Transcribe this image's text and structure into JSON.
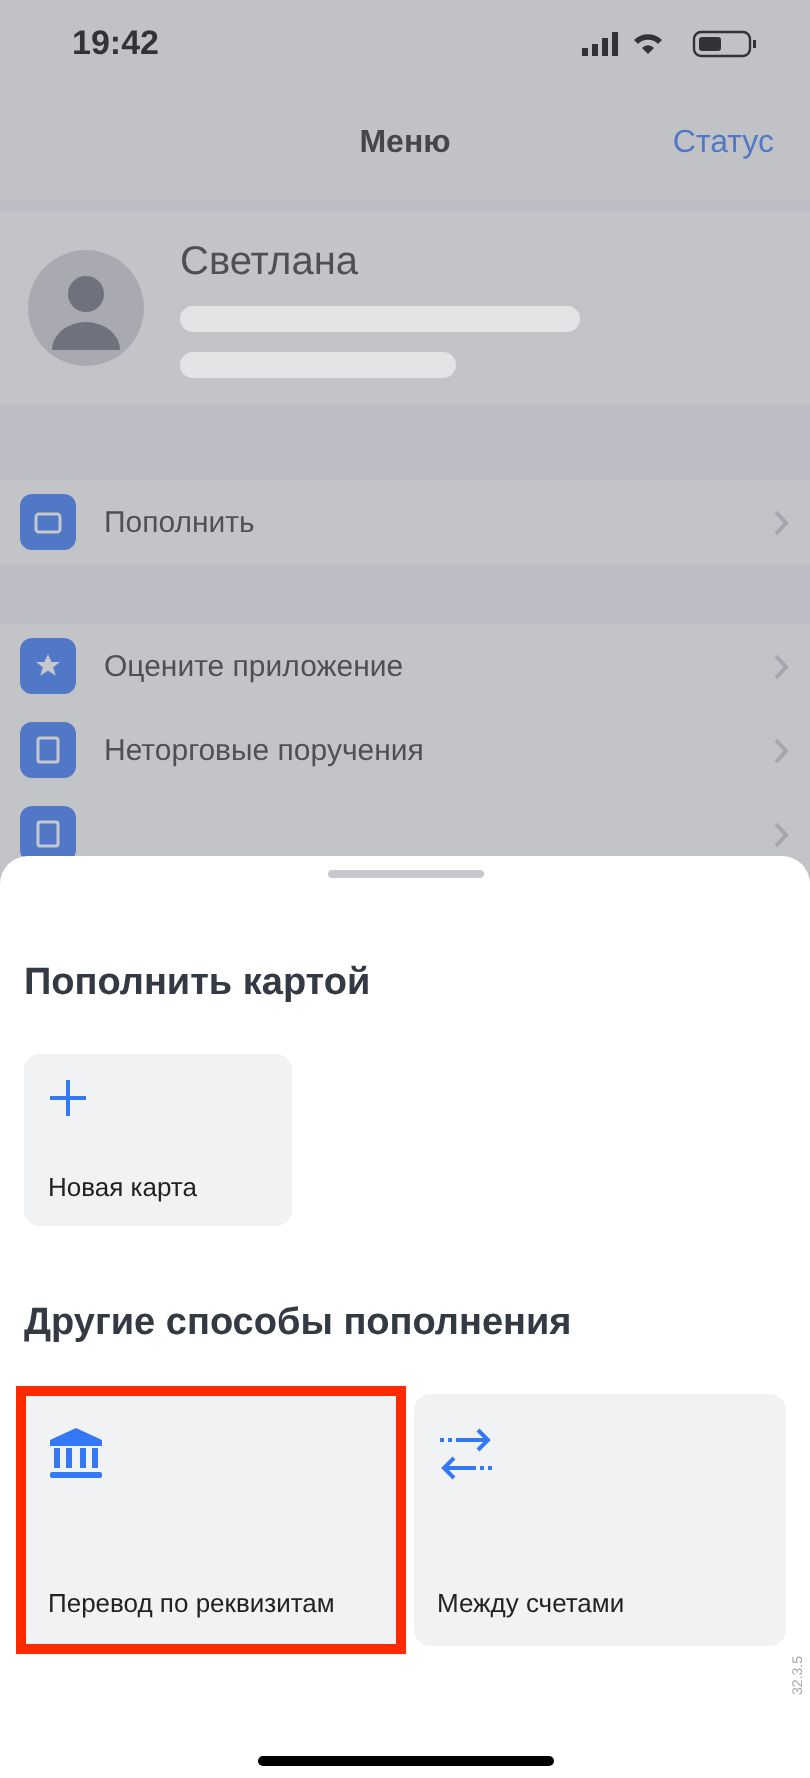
{
  "status_bar": {
    "time": "19:42"
  },
  "background": {
    "nav_title": "Меню",
    "nav_action": "Статус",
    "profile_name": "Светлана",
    "menu_items": [
      {
        "kind": "row",
        "label": "Пополнить"
      },
      {
        "kind": "row",
        "label": "Оцените приложение"
      },
      {
        "kind": "row",
        "label": "Неторговые поручения"
      },
      {
        "kind": "cut"
      }
    ]
  },
  "sheet": {
    "sections": [
      {
        "title": "Пополнить картой",
        "options": [
          {
            "label": "Новая карта",
            "highlighted": false
          }
        ]
      },
      {
        "title": "Другие способы пополнения",
        "options": [
          {
            "label": "Перевод по реквизитам",
            "highlighted": true
          },
          {
            "label": "Между счетами",
            "highlighted": false
          }
        ]
      }
    ],
    "version": "32.3.5"
  }
}
